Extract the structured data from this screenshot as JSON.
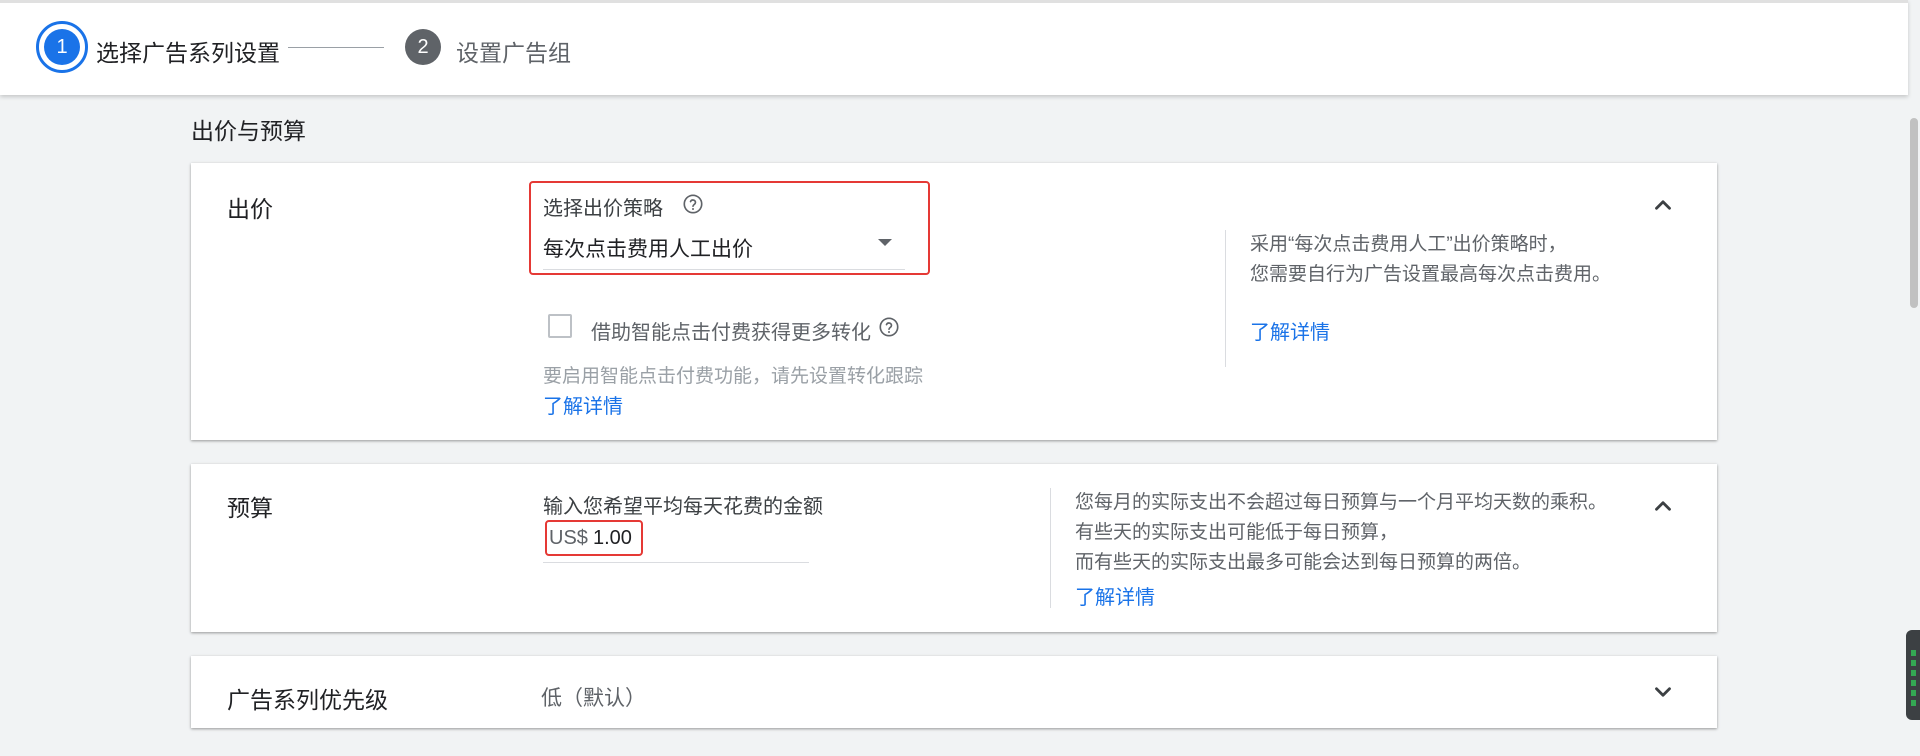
{
  "stepper": {
    "step1": {
      "number": "1",
      "label": "选择广告系列设置"
    },
    "step2": {
      "number": "2",
      "label": "设置广告组"
    }
  },
  "section_title": "出价与预算",
  "bidding": {
    "title": "出价",
    "strategy_label": "选择出价策略",
    "strategy_value": "每次点击费用人工出价",
    "checkbox_label": "借助智能点击付费获得更多转化",
    "hint": "要启用智能点击付费功能，请先设置转化跟踪",
    "learn_more": "了解详情",
    "side_line1": "采用“每次点击费用人工”出价策略时，",
    "side_line2": "您需要自行为广告设置最高每次点击费用。",
    "side_learn_more": "了解详情"
  },
  "budget": {
    "title": "预算",
    "input_label": "输入您希望平均每天花费的金额",
    "currency": "US$",
    "value": "1.00",
    "side_line1": "您每月的实际支出不会超过每日预算与一个月平均天数的乘积。",
    "side_line2": "有些天的实际支出可能低于每日预算，",
    "side_line3": "而有些天的实际支出最多可能会达到每日预算的两倍。",
    "side_learn_more": "了解详情"
  },
  "priority": {
    "title": "广告系列优先级",
    "value": "低（默认）"
  },
  "icons": {
    "help": "help-circle-icon",
    "collapse": "chevron-up-icon",
    "expand": "chevron-down-icon",
    "dropdown": "arrow-drop-down-icon"
  },
  "colors": {
    "accent": "#1a73e8",
    "highlight": "#e53935",
    "step_inactive": "#5f6368"
  }
}
